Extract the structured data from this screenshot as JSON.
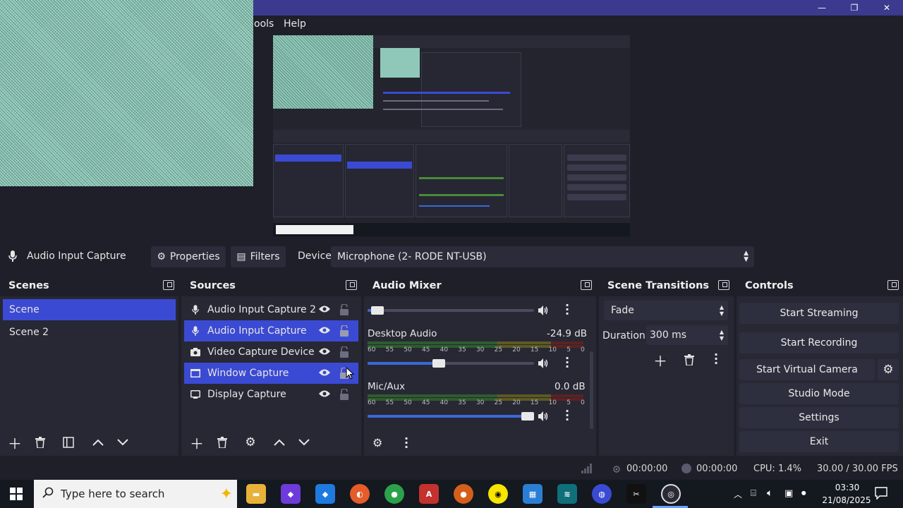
{
  "menubar": {
    "tools_partial": "ools",
    "help": "Help"
  },
  "window_controls": {
    "minimize": "—",
    "restore": "❐",
    "close": "✕"
  },
  "context_bar": {
    "source_name": "Audio Input Capture",
    "properties_label": "Properties",
    "filters_label": "Filters",
    "device_label": "Device",
    "device_value": "Microphone (2- RODE NT-USB)"
  },
  "scenes": {
    "title": "Scenes",
    "items": [
      {
        "label": "Scene",
        "selected": true
      },
      {
        "label": "Scene 2",
        "selected": false
      }
    ]
  },
  "sources": {
    "title": "Sources",
    "items": [
      {
        "label": "Audio Input Capture 2",
        "icon": "microphone-icon",
        "selected": false
      },
      {
        "label": "Audio Input Capture",
        "icon": "microphone-icon",
        "selected": true
      },
      {
        "label": "Video Capture Device",
        "icon": "camera-icon",
        "selected": false
      },
      {
        "label": "Window Capture",
        "icon": "window-icon",
        "selected": true
      },
      {
        "label": "Display Capture",
        "icon": "monitor-icon",
        "selected": false
      }
    ]
  },
  "audio_mixer": {
    "title": "Audio Mixer",
    "ticks": [
      "60",
      "55",
      "50",
      "45",
      "40",
      "35",
      "30",
      "25",
      "20",
      "15",
      "10",
      "5",
      "0"
    ],
    "tracks": [
      {
        "name": "Desktop Audio",
        "level": "-24.9 dB",
        "volume": 0.43
      },
      {
        "name": "Mic/Aux",
        "level": "0.0 dB",
        "volume": 0.96
      }
    ],
    "top_partial_volume": 0.06
  },
  "scene_transitions": {
    "title": "Scene Transitions",
    "transition": "Fade",
    "duration_label": "Duration",
    "duration_value": "300 ms"
  },
  "controls": {
    "title": "Controls",
    "start_streaming": "Start Streaming",
    "start_recording": "Start Recording",
    "start_virtual_camera": "Start Virtual Camera",
    "studio_mode": "Studio Mode",
    "settings": "Settings",
    "exit": "Exit"
  },
  "status": {
    "stream_time": "00:00:00",
    "record_time": "00:00:00",
    "cpu": "CPU: 1.4%",
    "fps": "30.00 / 30.00 FPS"
  },
  "taskbar": {
    "search_placeholder": "Type here to search",
    "time": "03:30",
    "date": "21/08/2025"
  },
  "colors": {
    "selection": "#3b4ad3",
    "panel": "#272834",
    "background": "#1e1f29",
    "titlebar": "#3b3a8e"
  }
}
